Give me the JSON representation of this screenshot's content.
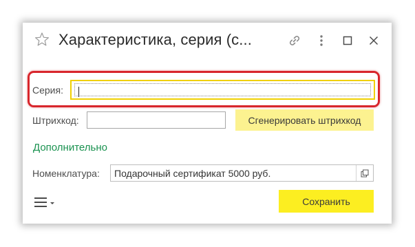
{
  "window": {
    "title": "Характеристика, серия (с...",
    "icons": {
      "favorite": "star-icon",
      "link": "link-icon",
      "more": "more-vertical-icon",
      "maximize": "maximize-icon",
      "close": "close-icon"
    }
  },
  "form": {
    "series": {
      "label": "Серия:",
      "value": ""
    },
    "barcode": {
      "label": "Штрихкод:",
      "value": "",
      "generate_button": "Сгенерировать штрихкод"
    },
    "additional_section": "Дополнительно",
    "nomenclature": {
      "label": "Номенклатура:",
      "value": "Подарочный сертификат 5000 руб."
    }
  },
  "footer": {
    "menu_icon": "hamburger-menu-icon",
    "save_button": "Сохранить"
  },
  "colors": {
    "accent_yellow": "#fcee21",
    "highlight_red": "#d8262c",
    "section_green": "#1a9250"
  }
}
